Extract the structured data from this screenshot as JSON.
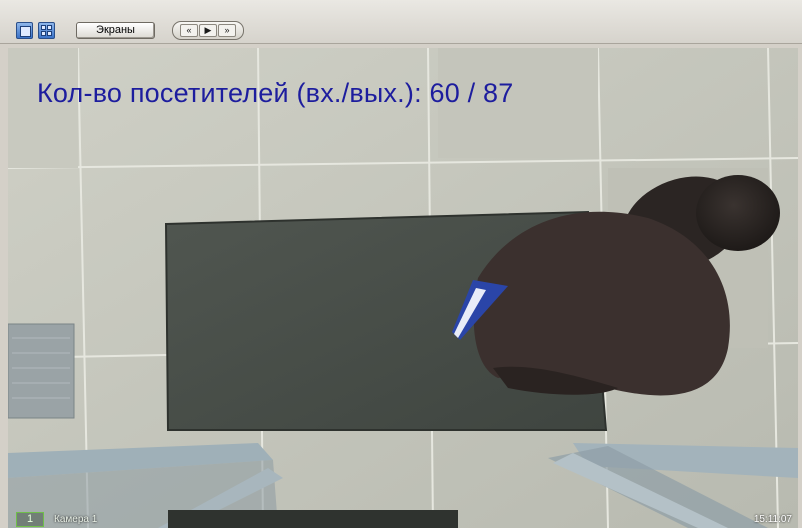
{
  "toolbar": {
    "screens_label": "Экраны",
    "single_view_icon": "single-screen-icon",
    "grid_view_icon": "grid-screens-icon",
    "nav": {
      "first_symbol": "«",
      "play_symbol": "▶",
      "last_symbol": "»"
    }
  },
  "camera": {
    "overlay_text": "Кол-во посетителей (вх./вых.): 60 / 87",
    "number": "1",
    "name": "Камера 1",
    "time": "15:11:07"
  },
  "colors": {
    "overlay_text": "#1d1d9e",
    "camera_badge_border": "#6fbf4a",
    "toolbar_bg": "#d4d0c8"
  }
}
